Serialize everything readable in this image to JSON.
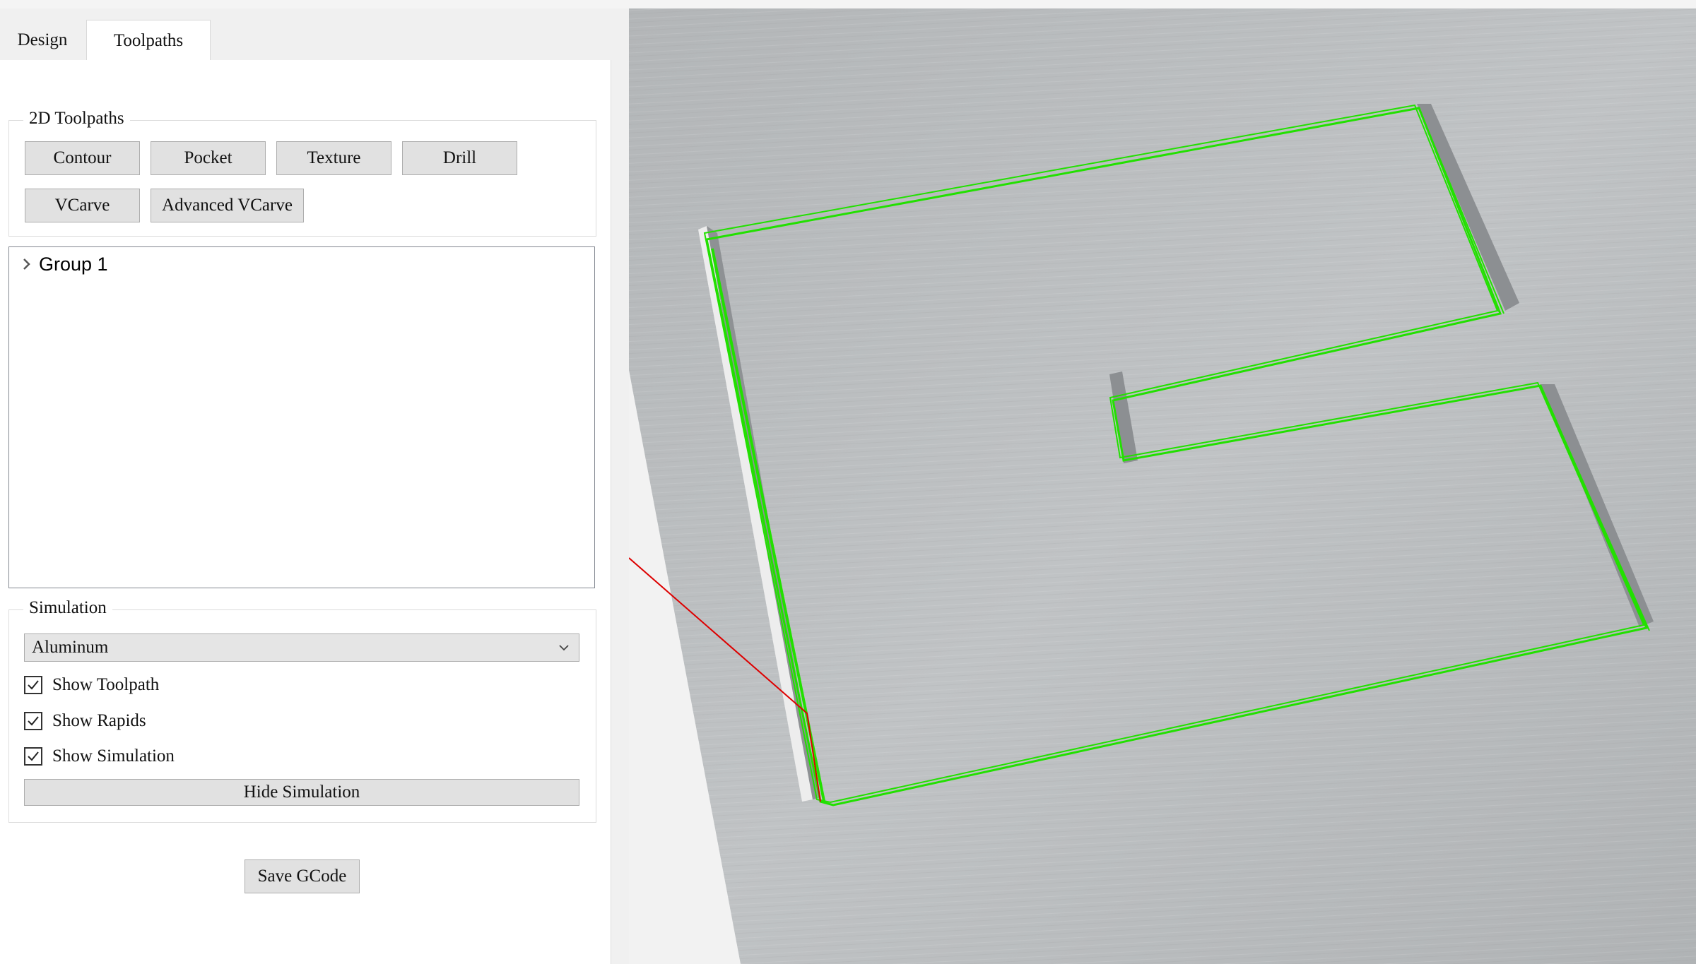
{
  "tabs": {
    "design": "Design",
    "toolpaths": "Toolpaths"
  },
  "toolpaths_2d": {
    "title": "2D Toolpaths",
    "buttons": [
      "Contour",
      "Pocket",
      "Texture",
      "Drill",
      "VCarve",
      "Advanced VCarve"
    ]
  },
  "tree": {
    "group_label": "Group 1"
  },
  "simulation": {
    "title": "Simulation",
    "material": "Aluminum",
    "show_toolpath": "Show Toolpath",
    "show_rapids": "Show Rapids",
    "show_simulation": "Show Simulation",
    "hide_button": "Hide Simulation"
  },
  "save_button": "Save GCode",
  "viewport": {
    "toolpath_color": "#22e000",
    "rapid_color": "#dd0000",
    "stock_color": "#b5b8bb"
  }
}
